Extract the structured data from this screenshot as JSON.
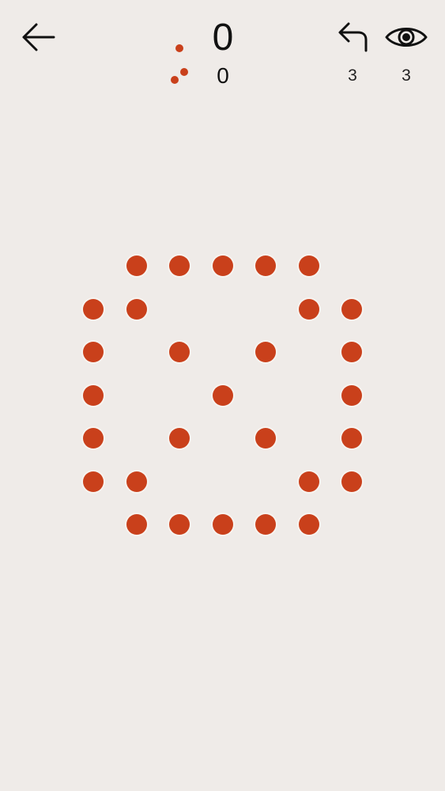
{
  "header": {
    "back_icon": "arrow-left-icon",
    "score_single_icon": "single-dot-icon",
    "score_pair_icon": "double-dot-icon",
    "score_primary": "0",
    "score_secondary": "0",
    "undo": {
      "icon": "undo-arrow-icon",
      "count": "3"
    },
    "reveal": {
      "icon": "eye-icon",
      "count": "3"
    }
  },
  "colors": {
    "background": "#efebe8",
    "dot": "#c9401b",
    "dot_outline": "#f7f3ef",
    "ink": "#111111"
  },
  "board": {
    "rows": 7,
    "cols": 7,
    "dots": [
      {
        "row": 0,
        "col": 1
      },
      {
        "row": 0,
        "col": 2
      },
      {
        "row": 0,
        "col": 3
      },
      {
        "row": 0,
        "col": 4
      },
      {
        "row": 0,
        "col": 5
      },
      {
        "row": 1,
        "col": 0
      },
      {
        "row": 1,
        "col": 1
      },
      {
        "row": 1,
        "col": 5
      },
      {
        "row": 1,
        "col": 6
      },
      {
        "row": 2,
        "col": 0
      },
      {
        "row": 2,
        "col": 2
      },
      {
        "row": 2,
        "col": 4
      },
      {
        "row": 2,
        "col": 6
      },
      {
        "row": 3,
        "col": 0
      },
      {
        "row": 3,
        "col": 3
      },
      {
        "row": 3,
        "col": 6
      },
      {
        "row": 4,
        "col": 0
      },
      {
        "row": 4,
        "col": 2
      },
      {
        "row": 4,
        "col": 4
      },
      {
        "row": 4,
        "col": 6
      },
      {
        "row": 5,
        "col": 0
      },
      {
        "row": 5,
        "col": 1
      },
      {
        "row": 5,
        "col": 5
      },
      {
        "row": 5,
        "col": 6
      },
      {
        "row": 6,
        "col": 1
      },
      {
        "row": 6,
        "col": 2
      },
      {
        "row": 6,
        "col": 3
      },
      {
        "row": 6,
        "col": 4
      },
      {
        "row": 6,
        "col": 5
      }
    ]
  }
}
